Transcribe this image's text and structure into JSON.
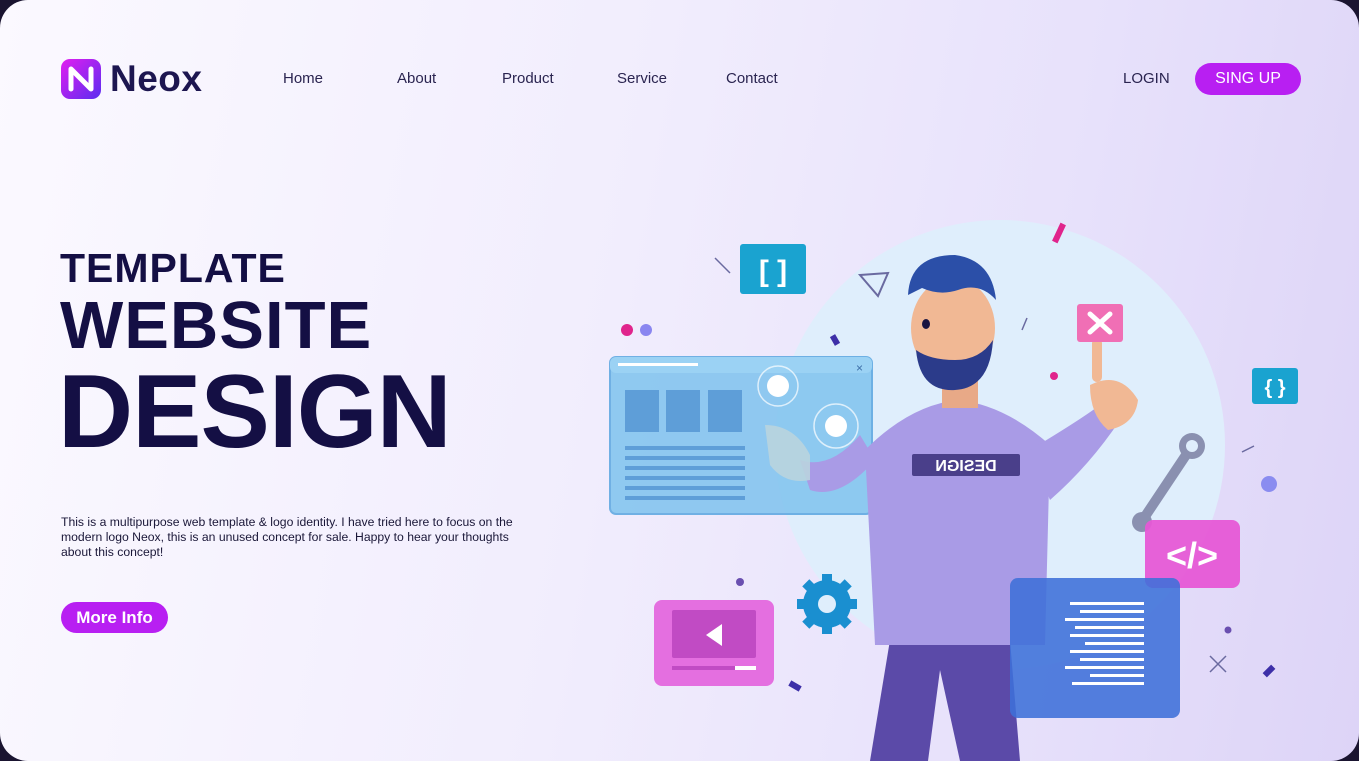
{
  "header": {
    "logo_text": "Neox",
    "nav": [
      "Home",
      "About",
      "Product",
      "Service",
      "Contact"
    ],
    "login_label": "LOGIN",
    "signup_label": "SING UP"
  },
  "hero": {
    "line1": "TEMPLATE",
    "line2": "WEBSITE",
    "line3": "DESIGN",
    "description": "This is a multipurpose web template & logo identity. I have tried here to focus on the modern logo Neox, this is an unused concept for sale. Happy to hear your thoughts about this concept!",
    "cta_label": "More Info"
  },
  "illustration": {
    "shirt_text": "DESIGN",
    "bracket_icon_left": "[ ]",
    "bracket_icon_right": "{ }",
    "code_icon": "</>"
  },
  "colors": {
    "accent": "#b81ff2",
    "heading": "#140f44",
    "background": "#f1edfd"
  }
}
